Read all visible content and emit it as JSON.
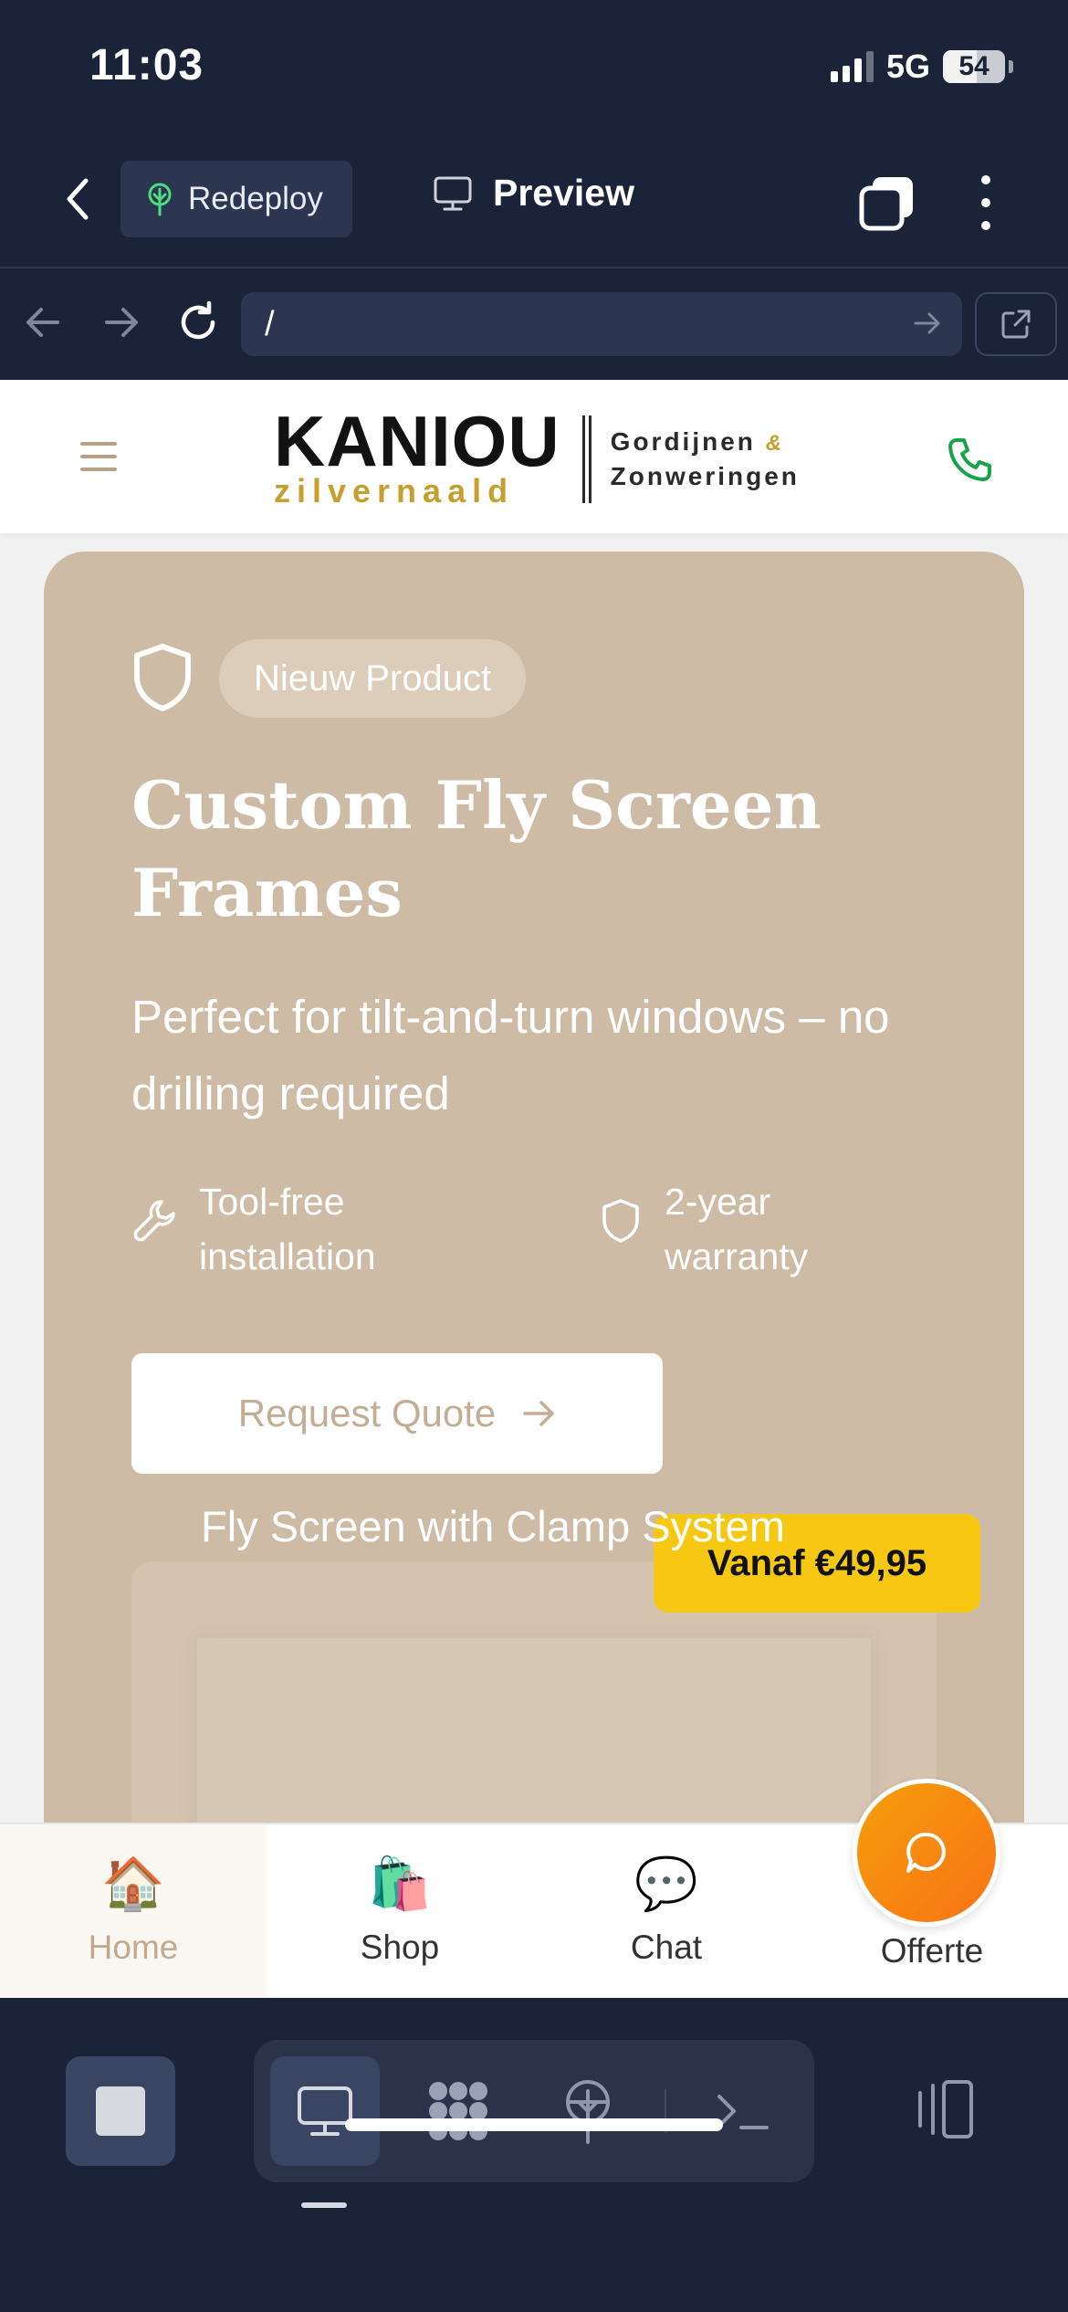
{
  "status": {
    "time": "11:03",
    "network": "5G",
    "battery": "54",
    "battery_level": 0.54
  },
  "app_bar": {
    "redeploy_label": "Redeploy",
    "preview_label": "Preview"
  },
  "url_bar": {
    "url": "/"
  },
  "site": {
    "logo": {
      "main": "KANIOU",
      "sub": "zilvernaald",
      "side_1": "Gordijnen",
      "amp": "&",
      "side_2": "Zonweringen"
    },
    "hero": {
      "badge": "Nieuw Product",
      "title": "Custom Fly Screen Frames",
      "subtitle": "Perfect for tilt-and-turn windows – no drilling required",
      "feature_1": "Tool-free installation",
      "feature_2": "2-year warranty",
      "cta": "Request Quote",
      "price": "Vanaf €49,95",
      "product_label": "Fly Screen with Clamp System"
    },
    "nav": [
      {
        "label": "Home",
        "emoji": "🏠"
      },
      {
        "label": "Shop",
        "emoji": "🛍️"
      },
      {
        "label": "Chat",
        "emoji": "💬"
      },
      {
        "label": "Offerte"
      }
    ]
  },
  "colors": {
    "hero_bg": "#cdbba6",
    "accent_gold": "#c6a02e",
    "price_yellow": "#f6c814",
    "fab_orange": "#f97316",
    "chrome_dark": "#1b2338"
  }
}
